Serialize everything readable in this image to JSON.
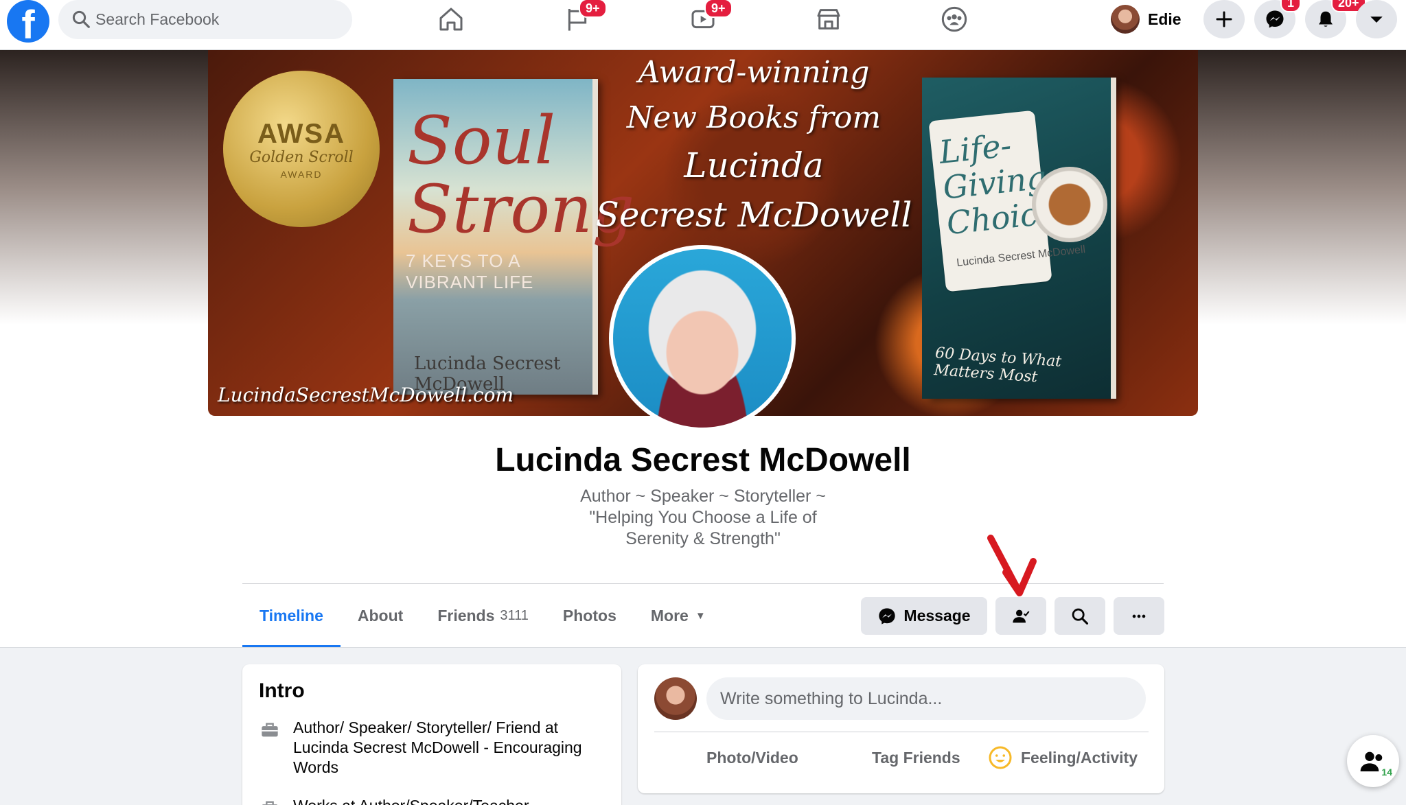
{
  "search": {
    "placeholder": "Search Facebook"
  },
  "nav": {
    "pages_badge": "9+",
    "watch_badge": "9+"
  },
  "user": {
    "name": "Edie"
  },
  "top_actions": {
    "messenger_badge": "1",
    "notifications_badge": "20+"
  },
  "cover": {
    "headline_line1": "Award-winning",
    "headline_line2": "New Books from",
    "headline_line3": "Lucinda",
    "headline_line4": "Secrest McDowell",
    "url": "LucindaSecrestMcDowell.com",
    "seal_title": "AWSA",
    "seal_sub": "Golden Scroll",
    "seal_award": "AWARD",
    "book1_title": "Soul Strong",
    "book1_subtitle": "7 KEYS TO A VIBRANT LIFE",
    "book1_author": "Lucinda Secrest McDowell",
    "book2_title": "Life-Giving Choices",
    "book2_author": "Lucinda Secrest McDowell",
    "book2_tagline": "60 Days to What Matters Most"
  },
  "profile": {
    "name": "Lucinda Secrest McDowell",
    "bio": "Author ~ Speaker ~ Storyteller ~ \"Helping You Choose a Life of Serenity & Strength\""
  },
  "tabs": [
    {
      "label": "Timeline",
      "active": true
    },
    {
      "label": "About"
    },
    {
      "label": "Friends",
      "count": "3111"
    },
    {
      "label": "Photos"
    },
    {
      "label": "More"
    }
  ],
  "actions": {
    "message_label": "Message"
  },
  "intro": {
    "title": "Intro",
    "items": [
      {
        "text": "Author/ Speaker/ Storyteller/ Friend at Lucinda Secrest McDowell - Encouraging Words"
      },
      {
        "text": "Works at Author/Speaker/Teacher"
      }
    ]
  },
  "composer": {
    "placeholder": "Write something to Lucinda...",
    "photo_video": "Photo/Video",
    "tag_friends": "Tag Friends",
    "feeling_activity": "Feeling/Activity"
  },
  "friends_fab": {
    "count": "14"
  },
  "colors": {
    "brand": "#1877f2",
    "badge": "#e41e3f",
    "annotation_arrow": "#d71920"
  }
}
